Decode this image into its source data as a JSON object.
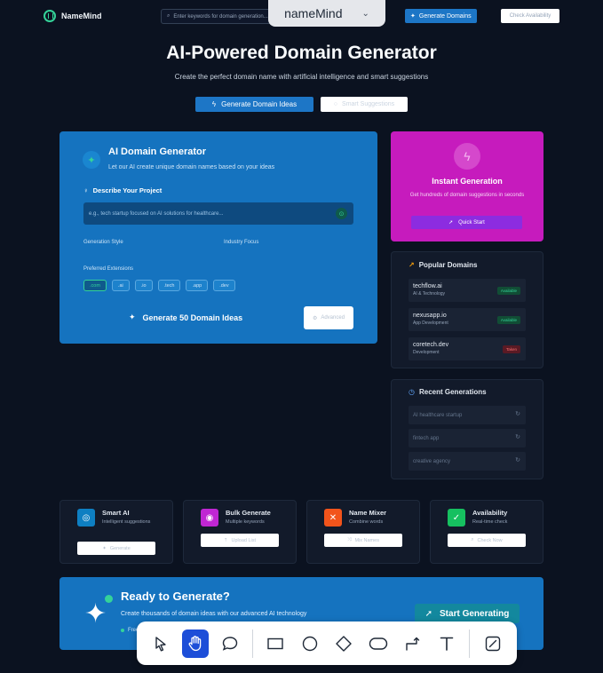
{
  "header": {
    "logo": "NameMind",
    "search_placeholder": "Enter keywords for domain generation...",
    "generate_btn": "Generate Domains",
    "availability_btn": "Check Availability",
    "tab_title": "nameMind"
  },
  "hero": {
    "title": "AI-Powered Domain Generator",
    "subtitle": "Create the perfect domain name with artificial intelligence and smart suggestions",
    "btn_primary": "Generate Domain Ideas",
    "btn_secondary": "Smart Suggestions"
  },
  "generator": {
    "title": "AI Domain Generator",
    "subtitle": "Let our AI create unique domain names based on your ideas",
    "describe_label": "Describe Your Project",
    "input_placeholder": "e.g., tech startup focused on AI solutions for healthcare...",
    "style_label": "Generation Style",
    "industry_label": "Industry Focus",
    "extensions_label": "Preferred Extensions",
    "extensions": [
      ".com",
      ".ai",
      ".io",
      ".tech",
      ".app",
      ".dev"
    ],
    "submit": "Generate 50 Domain Ideas",
    "advanced": "Advanced"
  },
  "instant": {
    "title": "Instant Generation",
    "subtitle": "Get hundreds of domain suggestions in seconds",
    "button": "Quick Start"
  },
  "popular": {
    "title": "Popular Domains",
    "items": [
      {
        "name": "techflow.ai",
        "category": "AI & Technology",
        "status": "Available"
      },
      {
        "name": "nexusapp.io",
        "category": "App Development",
        "status": "Available"
      },
      {
        "name": "coretech.dev",
        "category": "Development",
        "status": "Taken"
      }
    ]
  },
  "recent": {
    "title": "Recent Generations",
    "items": [
      "AI healthcare startup",
      "fintech app",
      "creative agency"
    ]
  },
  "features": [
    {
      "title": "Smart AI",
      "subtitle": "Intelligent suggestions",
      "button": "Generate",
      "color": "#0e7fc2"
    },
    {
      "title": "Bulk Generate",
      "subtitle": "Multiple keywords",
      "button": "Upload List",
      "color": "#c026d3"
    },
    {
      "title": "Name Mixer",
      "subtitle": "Combine words",
      "button": "Mix Names",
      "color": "#f2541b"
    },
    {
      "title": "Availability",
      "subtitle": "Real-time check",
      "button": "Check Now",
      "color": "#16c060"
    }
  ],
  "cta": {
    "title": "Ready to Generate?",
    "subtitle": "Create thousands of domain ideas with our advanced AI technology",
    "note": "Free to use",
    "button": "Start Generating"
  },
  "toolbar": {
    "tools": [
      "select-tool",
      "hand-tool",
      "comment-tool",
      "rectangle-tool",
      "ellipse-tool",
      "diamond-tool",
      "rounded-rect-tool",
      "connector-tool",
      "text-tool",
      "edit-tool"
    ],
    "active": "hand-tool"
  }
}
